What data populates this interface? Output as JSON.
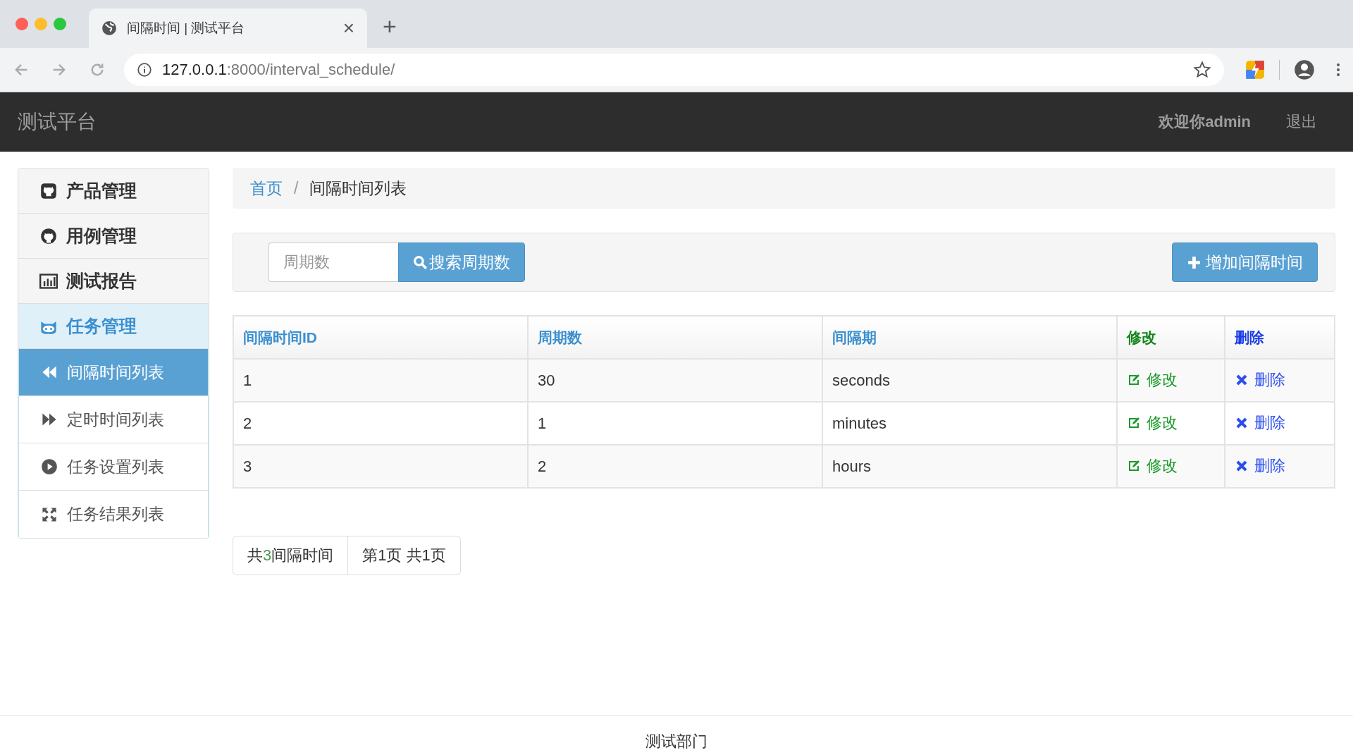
{
  "browser": {
    "tab_title": "间隔时间 | 测试平台",
    "tab_close": "×",
    "new_tab": "+",
    "url_host": "127.0.0.1",
    "url_rest": ":8000/interval_schedule/"
  },
  "navbar": {
    "brand": "测试平台",
    "welcome": "欢迎你admin",
    "logout": "退出"
  },
  "sidebar": {
    "items": [
      {
        "kind": "group",
        "label": "产品管理",
        "selected": false
      },
      {
        "kind": "group",
        "label": "用例管理",
        "selected": false
      },
      {
        "kind": "group",
        "label": "测试报告",
        "selected": false
      },
      {
        "kind": "group",
        "label": "任务管理",
        "selected": true
      },
      {
        "kind": "sub",
        "label": "间隔时间列表",
        "selected": true
      },
      {
        "kind": "sub",
        "label": "定时时间列表",
        "selected": false
      },
      {
        "kind": "sub",
        "label": "任务设置列表",
        "selected": false
      },
      {
        "kind": "sub",
        "label": "任务结果列表",
        "selected": false
      }
    ]
  },
  "breadcrumb": {
    "separator": "/",
    "items": [
      {
        "label": "首页",
        "kind": "link"
      },
      {
        "label": "间隔时间列表",
        "kind": "current"
      }
    ]
  },
  "search": {
    "placeholder": "周期数",
    "button": "搜索周期数"
  },
  "add_button": "增加间隔时间",
  "table": {
    "columns": [
      {
        "label": "间隔时间ID",
        "color": "#3a8fcf"
      },
      {
        "label": "周期数",
        "color": "#3a8fcf"
      },
      {
        "label": "间隔期",
        "color": "#3a8fcf"
      },
      {
        "label": "修改",
        "color": "#14861c"
      },
      {
        "label": "删除",
        "color": "#1a3be6"
      }
    ],
    "rows": [
      {
        "id": "1",
        "every": "30",
        "period": "seconds",
        "edit": "修改",
        "delete": "删除"
      },
      {
        "id": "2",
        "every": "1",
        "period": "minutes",
        "edit": "修改",
        "delete": "删除"
      },
      {
        "id": "3",
        "every": "2",
        "period": "hours",
        "edit": "修改",
        "delete": "删除"
      }
    ]
  },
  "pagination": {
    "total_prefix": "共",
    "total_count": "3",
    "total_suffix": "间隔时间",
    "pages": "第1页 共1页"
  },
  "footer": "测试部门"
}
